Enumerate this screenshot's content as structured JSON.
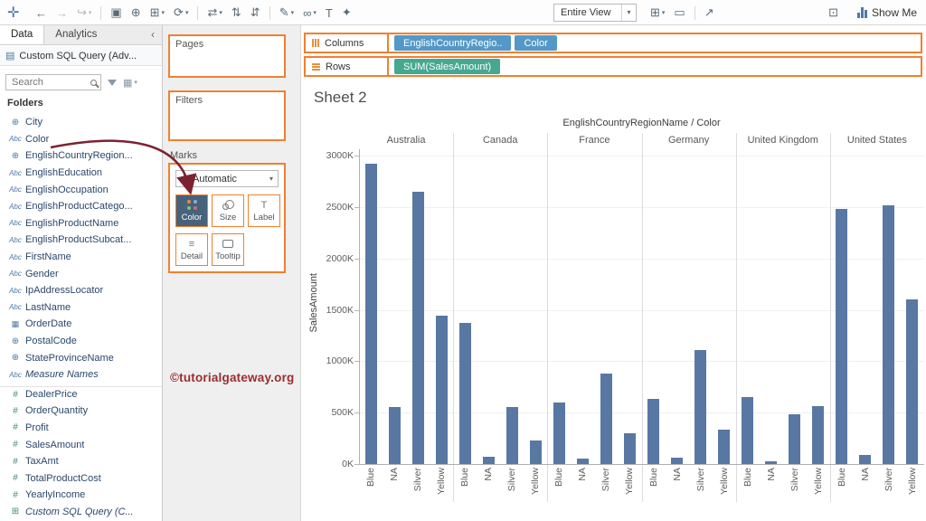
{
  "colors": {
    "accent_orange": "#f08030",
    "pill_blue": "#5498c7",
    "pill_green": "#46a890",
    "bar_blue": "#5878a3",
    "arrow_red": "#7d2230",
    "watermark_red": "#9b2d30"
  },
  "toolbar": {
    "logo_glyph": "✛",
    "left_icons": [
      {
        "name": "undo-icon",
        "glyph": "←"
      },
      {
        "name": "redo-icon",
        "glyph": "→",
        "dim": true
      },
      {
        "name": "replay-icon",
        "glyph": "↪",
        "caret": true,
        "dim": true
      },
      {
        "sep": true
      },
      {
        "name": "save-icon",
        "glyph": "▣"
      },
      {
        "name": "new-datasource-icon",
        "glyph": "⊕"
      },
      {
        "name": "new-worksheet-icon",
        "glyph": "⊞",
        "caret": true
      },
      {
        "name": "refresh-icon",
        "glyph": "⟳",
        "caret": true
      },
      {
        "sep": true
      },
      {
        "name": "swap-rows-columns-icon",
        "glyph": "⇄",
        "caret": true
      },
      {
        "name": "sort-ascending-icon",
        "glyph": "⇅"
      },
      {
        "name": "sort-descending-icon",
        "glyph": "⇵"
      },
      {
        "sep": true
      },
      {
        "name": "highlight-icon",
        "glyph": "✎",
        "caret": true
      },
      {
        "name": "group-members-icon",
        "glyph": "∞",
        "caret": true
      },
      {
        "name": "show-mark-labels-icon",
        "glyph": "T"
      },
      {
        "name": "fix-axes-icon",
        "glyph": "✦"
      }
    ],
    "fit_dropdown_value": "Entire View",
    "right_icons": [
      {
        "name": "cells-icon",
        "glyph": "⊞",
        "caret": true
      },
      {
        "name": "presentation-mode-icon",
        "glyph": "▭"
      },
      {
        "sep": true
      },
      {
        "name": "share-icon",
        "glyph": "↗"
      }
    ],
    "window_icon_glyph": "⊡",
    "show_me_label": "Show Me"
  },
  "sidebar": {
    "tab_data": "Data",
    "tab_analytics": "Analytics",
    "collapse_glyph": "‹",
    "datasource": "Custom SQL Query (Adv...",
    "search_placeholder": "Search",
    "folders_label": "Folders",
    "fields": [
      {
        "icon": "globe",
        "label": "City"
      },
      {
        "icon": "abc",
        "label": "Color"
      },
      {
        "icon": "globe",
        "label": "EnglishCountryRegion..."
      },
      {
        "icon": "abc",
        "label": "EnglishEducation"
      },
      {
        "icon": "abc",
        "label": "EnglishOccupation"
      },
      {
        "icon": "abc",
        "label": "EnglishProductCatego..."
      },
      {
        "icon": "abc",
        "label": "EnglishProductName"
      },
      {
        "icon": "abc",
        "label": "EnglishProductSubcat..."
      },
      {
        "icon": "abc",
        "label": "FirstName"
      },
      {
        "icon": "abc",
        "label": "Gender"
      },
      {
        "icon": "abc",
        "label": "IpAddressLocator"
      },
      {
        "icon": "abc",
        "label": "LastName"
      },
      {
        "icon": "calendar",
        "label": "OrderDate"
      },
      {
        "icon": "globe",
        "label": "PostalCode"
      },
      {
        "icon": "globe",
        "label": "StateProvinceName"
      },
      {
        "icon": "abc",
        "label": "Measure Names",
        "italic": true
      },
      {
        "icon": "hash",
        "label": "DealerPrice",
        "divider": true
      },
      {
        "icon": "hash",
        "label": "OrderQuantity"
      },
      {
        "icon": "hash",
        "label": "Profit"
      },
      {
        "icon": "hash",
        "label": "SalesAmount"
      },
      {
        "icon": "hash",
        "label": "TaxAmt"
      },
      {
        "icon": "hash",
        "label": "TotalProductCost"
      },
      {
        "icon": "hash",
        "label": "YearlyIncome"
      },
      {
        "icon": "table",
        "label": "Custom SQL Query (C...",
        "italic": true
      }
    ]
  },
  "cards": {
    "pages_label": "Pages",
    "filters_label": "Filters",
    "marks_label": "Marks",
    "marks_type": "Automatic",
    "marks_buttons": [
      {
        "label": "Color",
        "row": 1,
        "selected": true,
        "icon": "color-dots"
      },
      {
        "label": "Size",
        "row": 1,
        "icon": "size"
      },
      {
        "label": "Label",
        "row": 1,
        "icon": "label"
      },
      {
        "label": "Detail",
        "row": 2,
        "icon": "detail"
      },
      {
        "label": "Tooltip",
        "row": 2,
        "icon": "tooltip"
      }
    ],
    "watermark": "©tutorialgateway.org"
  },
  "shelves": {
    "columns_label": "Columns",
    "rows_label": "Rows",
    "columns_pills": [
      {
        "label": "EnglishCountryRegio..",
        "type": "dimension"
      },
      {
        "label": "Color",
        "type": "dimension"
      }
    ],
    "rows_pills": [
      {
        "label": "SUM(SalesAmount)",
        "type": "measure"
      }
    ]
  },
  "sheet": {
    "title": "Sheet 2"
  },
  "chart_data": {
    "type": "bar",
    "title": "Sheet 2",
    "column_header": "EnglishCountryRegionName / Color",
    "ylabel": "SalesAmount",
    "unit": "K",
    "ylim": [
      0,
      3000
    ],
    "yticks": [
      "0K",
      "500K",
      "1000K",
      "1500K",
      "2000K",
      "2500K",
      "3000K"
    ],
    "subcategories": [
      "Blue",
      "NA",
      "Silver",
      "Yellow"
    ],
    "groups": [
      {
        "country": "Australia",
        "values": [
          2920,
          550,
          2650,
          1440
        ]
      },
      {
        "country": "Canada",
        "values": [
          1370,
          70,
          550,
          230
        ]
      },
      {
        "country": "France",
        "values": [
          600,
          50,
          880,
          300
        ]
      },
      {
        "country": "Germany",
        "values": [
          630,
          60,
          1110,
          330
        ]
      },
      {
        "country": "United Kingdom",
        "values": [
          650,
          30,
          480,
          560
        ]
      },
      {
        "country": "United States",
        "values": [
          2480,
          90,
          2520,
          1600
        ]
      }
    ],
    "bar_color": "#5878a3",
    "grid": "horizontal-light",
    "legend": "none"
  }
}
